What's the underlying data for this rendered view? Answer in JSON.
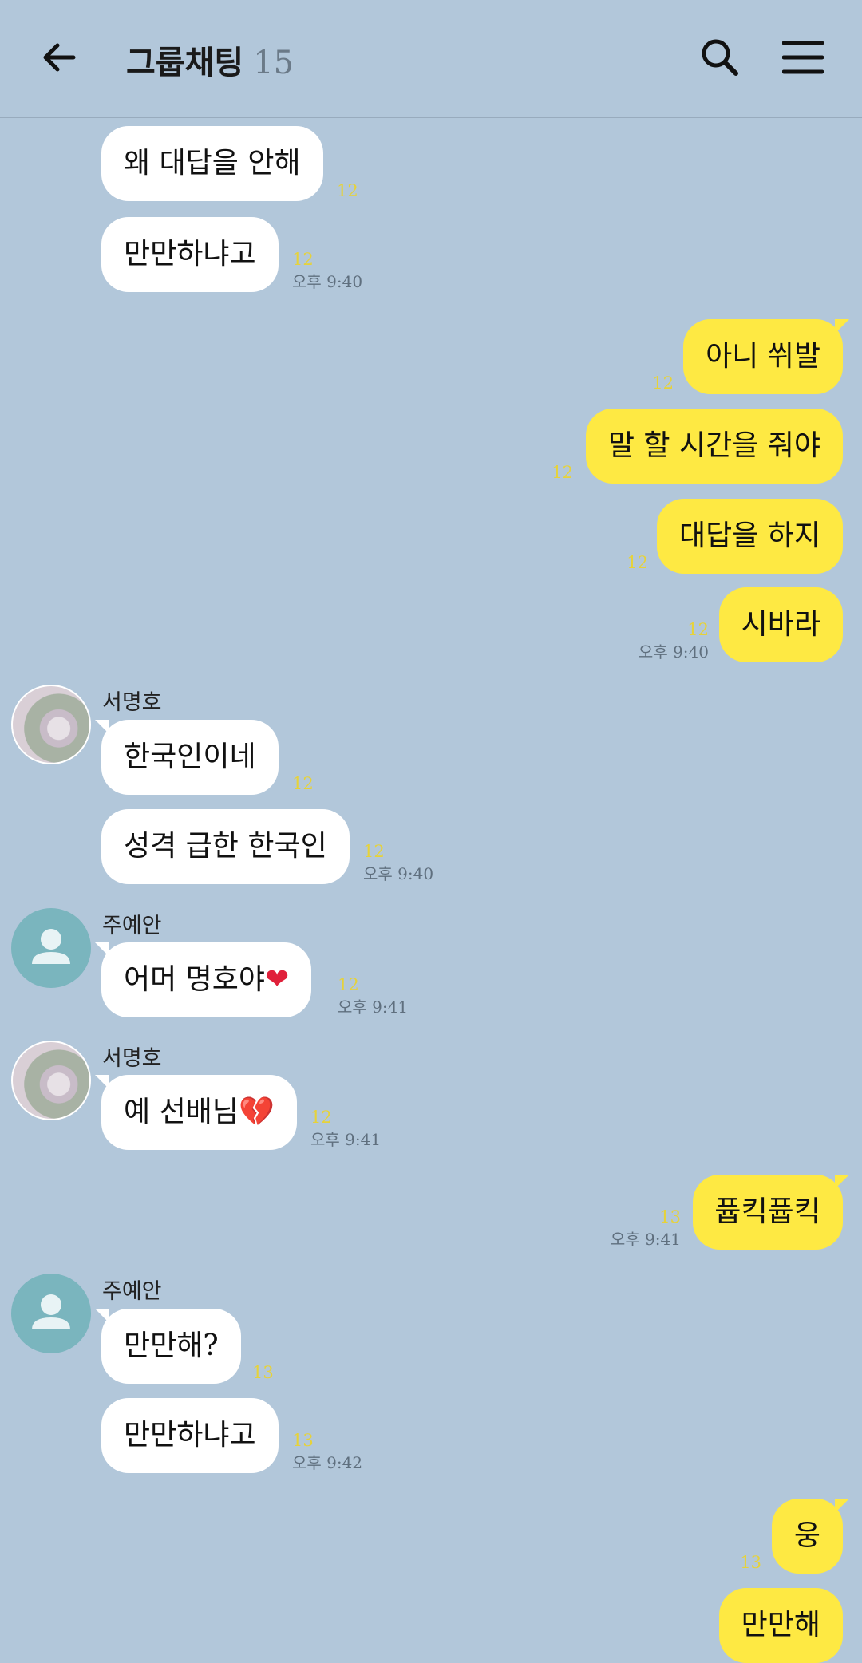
{
  "header": {
    "title": "그룹채팅",
    "member_count": "15"
  },
  "messages": [
    {
      "text": "왜 대답을 안해",
      "unread": "12"
    },
    {
      "text": "만만하냐고",
      "unread": "12",
      "time": "오후 9:40"
    },
    {
      "text": "아니 쒸발",
      "unread": "12"
    },
    {
      "text": "말 할 시간을 줘야",
      "unread": "12"
    },
    {
      "text": "대답을 하지",
      "unread": "12"
    },
    {
      "text": "시바라",
      "unread": "12",
      "time": "오후 9:40"
    },
    {
      "sender": "서명호",
      "text": "한국인이네",
      "unread": "12"
    },
    {
      "text": "성격 급한 한국인",
      "unread": "12",
      "time": "오후 9:40"
    },
    {
      "sender": "주예안",
      "text": "어머 명호야",
      "emoji": "❤",
      "unread": "12",
      "time": "오후 9:41"
    },
    {
      "sender": "서명호",
      "text": "예 선배님",
      "emoji": "💔",
      "unread": "12",
      "time": "오후 9:41"
    },
    {
      "text": "퓹킥퓹킥",
      "unread": "13",
      "time": "오후 9:41"
    },
    {
      "sender": "주예안",
      "text": "만만해?",
      "unread": "13"
    },
    {
      "text": "만만하냐고",
      "unread": "13",
      "time": "오후 9:42"
    },
    {
      "text": "웅",
      "unread": "13"
    },
    {
      "text": "만만해"
    }
  ],
  "colors": {
    "background": "#b2c7da",
    "my_bubble": "#fee943",
    "other_bubble": "#ffffff",
    "unread": "#e6d23a"
  },
  "icons": {
    "back": "arrow-left-icon",
    "search": "search-icon",
    "menu": "hamburger-menu-icon",
    "avatar_default": "default-person-icon"
  }
}
